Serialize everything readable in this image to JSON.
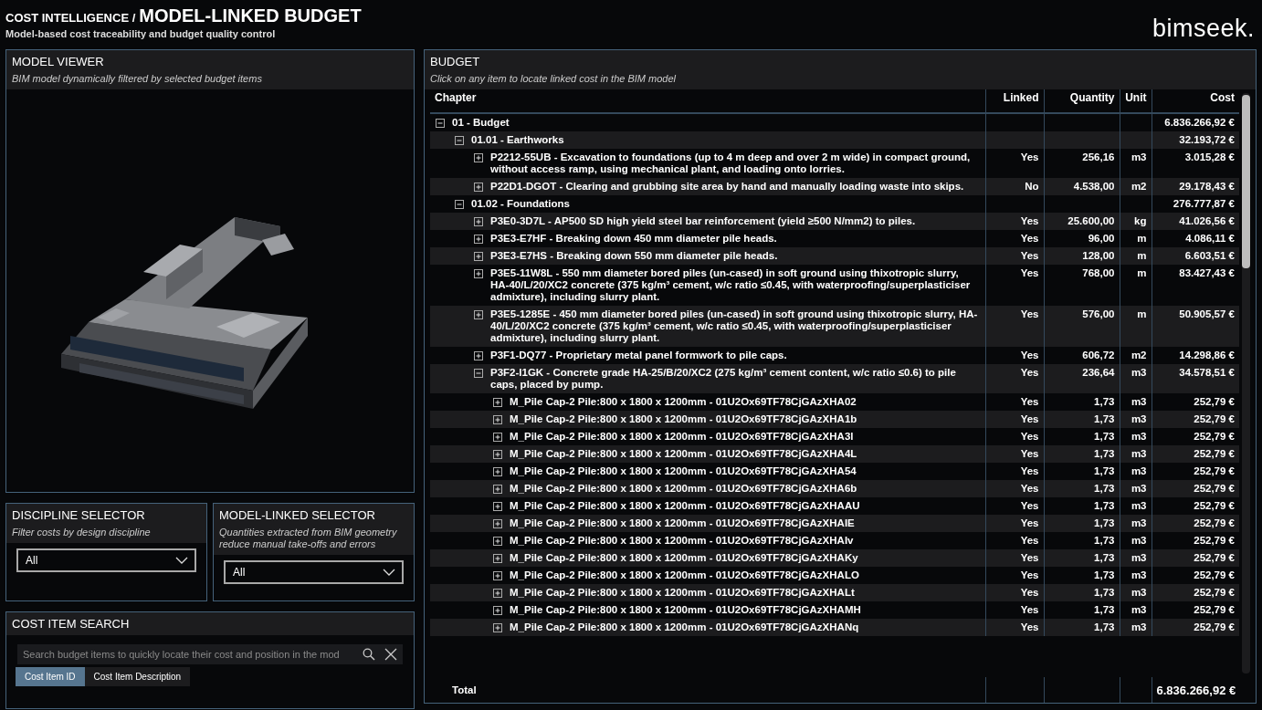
{
  "header": {
    "section": "COST INTELLIGENCE /",
    "title": "MODEL-LINKED BUDGET",
    "subtitle": "Model-based cost traceability and budget quality control",
    "logo": "bimseek."
  },
  "model_viewer": {
    "title": "MODEL VIEWER",
    "subtitle": "BIM model dynamically filtered by selected budget items",
    "kind": "picture"
  },
  "discipline_selector": {
    "title": "DISCIPLINE SELECTOR",
    "subtitle": "Filter costs by design discipline",
    "value": "All"
  },
  "model_linked_selector": {
    "title": "MODEL-LINKED SELECTOR",
    "subtitle": "Quantities extracted from BIM geometry reduce manual take-offs and errors",
    "value": "All"
  },
  "cost_item_search": {
    "title": "COST ITEM SEARCH",
    "placeholder": "Search budget items to quickly locate their cost and position in the mod",
    "modes": [
      {
        "label": "Cost Item ID",
        "selected": true
      },
      {
        "label": "Cost Item Description",
        "selected": false
      }
    ]
  },
  "budget": {
    "title": "BUDGET",
    "subtitle": "Click on any item to locate linked cost in the BIM model",
    "columns": [
      "Chapter",
      "Linked",
      "Quantity",
      "Unit",
      "Cost"
    ],
    "rows": [
      {
        "chapter": "01 - Budget",
        "cost": "6.836.266,92 €",
        "expanded": true,
        "children": [
          {
            "chapter": "01.01 - Earthworks",
            "cost": "32.193,72 €",
            "expanded": true,
            "children": [
              {
                "chapter": "P2212-55UB - Excavation to foundations (up to 4 m deep and over 2 m wide) in compact ground, without access ramp, using mechanical plant, and loading onto lorries.",
                "linked": "Yes",
                "quantity": "256,16",
                "unit": "m3",
                "cost": "3.015,28 €",
                "expanded": false
              },
              {
                "chapter": "P22D1-DGOT - Clearing and grubbing site area by hand and manually loading waste into skips.",
                "linked": "No",
                "quantity": "4.538,00",
                "unit": "m2",
                "cost": "29.178,43 €",
                "expanded": false
              }
            ]
          },
          {
            "chapter": "01.02 - Foundations",
            "cost": "276.777,87 €",
            "expanded": true,
            "children": [
              {
                "chapter": "P3E0-3D7L - AP500 SD high yield steel bar reinforcement (yield ≥500 N/mm2) to piles.",
                "linked": "Yes",
                "quantity": "25.600,00",
                "unit": "kg",
                "cost": "41.026,56 €",
                "expanded": false
              },
              {
                "chapter": "P3E3-E7HF - Breaking down 450 mm diameter pile heads.",
                "linked": "Yes",
                "quantity": "96,00",
                "unit": "m",
                "cost": "4.086,11 €",
                "expanded": false
              },
              {
                "chapter": "P3E3-E7HS - Breaking down 550 mm diameter pile heads.",
                "linked": "Yes",
                "quantity": "128,00",
                "unit": "m",
                "cost": "6.603,51 €",
                "expanded": false
              },
              {
                "chapter": "P3E5-11W8L - 550 mm diameter bored piles (un-cased) in soft ground using thixotropic slurry, HA-40/L/20/XC2 concrete (375 kg/m³ cement, w/c ratio ≤0.45, with waterproofing/superplasticiser admixture), including slurry plant.",
                "linked": "Yes",
                "quantity": "768,00",
                "unit": "m",
                "cost": "83.427,43 €",
                "expanded": false
              },
              {
                "chapter": "P3E5-1285E - 450 mm diameter bored piles (un-cased) in soft ground using thixotropic slurry, HA-40/L/20/XC2 concrete (375 kg/m³ cement, w/c ratio ≤0.45, with waterproofing/superplasticiser admixture), including slurry plant.",
                "linked": "Yes",
                "quantity": "576,00",
                "unit": "m",
                "cost": "50.905,57 €",
                "expanded": false
              },
              {
                "chapter": "P3F1-DQ77 - Proprietary metal panel formwork to pile caps.",
                "linked": "Yes",
                "quantity": "606,72",
                "unit": "m2",
                "cost": "14.298,86 €",
                "expanded": false
              },
              {
                "chapter": "P3F2-I1GK - Concrete grade HA-25/B/20/XC2 (275 kg/m³ cement content, w/c ratio ≤0.6) to pile caps, placed by pump.",
                "linked": "Yes",
                "quantity": "236,64",
                "unit": "m3",
                "cost": "34.578,51 €",
                "expanded": true,
                "children": [
                  {
                    "chapter": "M_Pile Cap-2 Pile:800 x 1800 x 1200mm - 01U2Ox69TF78CjGAzXHA02",
                    "linked": "Yes",
                    "quantity": "1,73",
                    "unit": "m3",
                    "cost": "252,79 €",
                    "expanded": false
                  },
                  {
                    "chapter": "M_Pile Cap-2 Pile:800 x 1800 x 1200mm - 01U2Ox69TF78CjGAzXHA1b",
                    "linked": "Yes",
                    "quantity": "1,73",
                    "unit": "m3",
                    "cost": "252,79 €",
                    "expanded": false
                  },
                  {
                    "chapter": "M_Pile Cap-2 Pile:800 x 1800 x 1200mm - 01U2Ox69TF78CjGAzXHA3l",
                    "linked": "Yes",
                    "quantity": "1,73",
                    "unit": "m3",
                    "cost": "252,79 €",
                    "expanded": false
                  },
                  {
                    "chapter": "M_Pile Cap-2 Pile:800 x 1800 x 1200mm - 01U2Ox69TF78CjGAzXHA4L",
                    "linked": "Yes",
                    "quantity": "1,73",
                    "unit": "m3",
                    "cost": "252,79 €",
                    "expanded": false
                  },
                  {
                    "chapter": "M_Pile Cap-2 Pile:800 x 1800 x 1200mm - 01U2Ox69TF78CjGAzXHA54",
                    "linked": "Yes",
                    "quantity": "1,73",
                    "unit": "m3",
                    "cost": "252,79 €",
                    "expanded": false
                  },
                  {
                    "chapter": "M_Pile Cap-2 Pile:800 x 1800 x 1200mm - 01U2Ox69TF78CjGAzXHA6b",
                    "linked": "Yes",
                    "quantity": "1,73",
                    "unit": "m3",
                    "cost": "252,79 €",
                    "expanded": false
                  },
                  {
                    "chapter": "M_Pile Cap-2 Pile:800 x 1800 x 1200mm - 01U2Ox69TF78CjGAzXHAAU",
                    "linked": "Yes",
                    "quantity": "1,73",
                    "unit": "m3",
                    "cost": "252,79 €",
                    "expanded": false
                  },
                  {
                    "chapter": "M_Pile Cap-2 Pile:800 x 1800 x 1200mm - 01U2Ox69TF78CjGAzXHAIE",
                    "linked": "Yes",
                    "quantity": "1,73",
                    "unit": "m3",
                    "cost": "252,79 €",
                    "expanded": false
                  },
                  {
                    "chapter": "M_Pile Cap-2 Pile:800 x 1800 x 1200mm - 01U2Ox69TF78CjGAzXHAIv",
                    "linked": "Yes",
                    "quantity": "1,73",
                    "unit": "m3",
                    "cost": "252,79 €",
                    "expanded": false
                  },
                  {
                    "chapter": "M_Pile Cap-2 Pile:800 x 1800 x 1200mm - 01U2Ox69TF78CjGAzXHAKy",
                    "linked": "Yes",
                    "quantity": "1,73",
                    "unit": "m3",
                    "cost": "252,79 €",
                    "expanded": false
                  },
                  {
                    "chapter": "M_Pile Cap-2 Pile:800 x 1800 x 1200mm - 01U2Ox69TF78CjGAzXHALO",
                    "linked": "Yes",
                    "quantity": "1,73",
                    "unit": "m3",
                    "cost": "252,79 €",
                    "expanded": false
                  },
                  {
                    "chapter": "M_Pile Cap-2 Pile:800 x 1800 x 1200mm - 01U2Ox69TF78CjGAzXHALt",
                    "linked": "Yes",
                    "quantity": "1,73",
                    "unit": "m3",
                    "cost": "252,79 €",
                    "expanded": false
                  },
                  {
                    "chapter": "M_Pile Cap-2 Pile:800 x 1800 x 1200mm - 01U2Ox69TF78CjGAzXHAMH",
                    "linked": "Yes",
                    "quantity": "1,73",
                    "unit": "m3",
                    "cost": "252,79 €",
                    "expanded": false
                  },
                  {
                    "chapter": "M_Pile Cap-2 Pile:800 x 1800 x 1200mm - 01U2Ox69TF78CjGAzXHANq",
                    "linked": "Yes",
                    "quantity": "1,73",
                    "unit": "m3",
                    "cost": "252,79 €",
                    "expanded": false
                  }
                ]
              }
            ]
          }
        ]
      }
    ],
    "total": {
      "label": "Total",
      "cost": "6.836.266,92 €"
    }
  }
}
